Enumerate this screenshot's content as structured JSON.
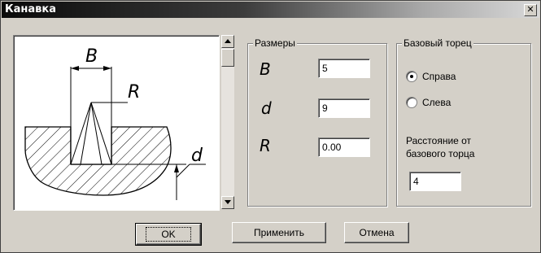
{
  "window": {
    "title": "Канавка",
    "close_glyph": "✕"
  },
  "preview": {
    "labels": {
      "b": "B",
      "r": "R",
      "d": "d"
    }
  },
  "sizes_group": {
    "label": "Размеры",
    "params": [
      {
        "name": "B",
        "value": "5"
      },
      {
        "name": "d",
        "value": "9"
      },
      {
        "name": "R",
        "value": "0.00"
      }
    ]
  },
  "base_group": {
    "label": "Базовый торец",
    "option_right": "Справа",
    "option_left": "Слева",
    "selected": "right",
    "distance_label_line1": "Расстояние от",
    "distance_label_line2": "базового торца",
    "distance_value": "4"
  },
  "buttons": {
    "ok": "OK",
    "apply": "Применить",
    "cancel": "Отмена"
  }
}
